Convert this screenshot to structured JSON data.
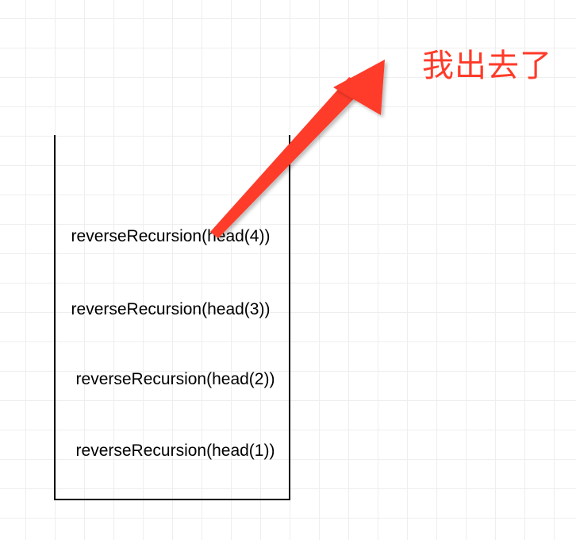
{
  "annotation": {
    "label": "我出去了",
    "color": "#ff3b29"
  },
  "stack": {
    "items": [
      {
        "label": "reverseRecursion(head(4))"
      },
      {
        "label": "reverseRecursion(head(3))"
      },
      {
        "label": "reverseRecursion(head(2))"
      },
      {
        "label": "reverseRecursion(head(1))"
      }
    ]
  },
  "arrow": {
    "color": "#ff3b29"
  }
}
